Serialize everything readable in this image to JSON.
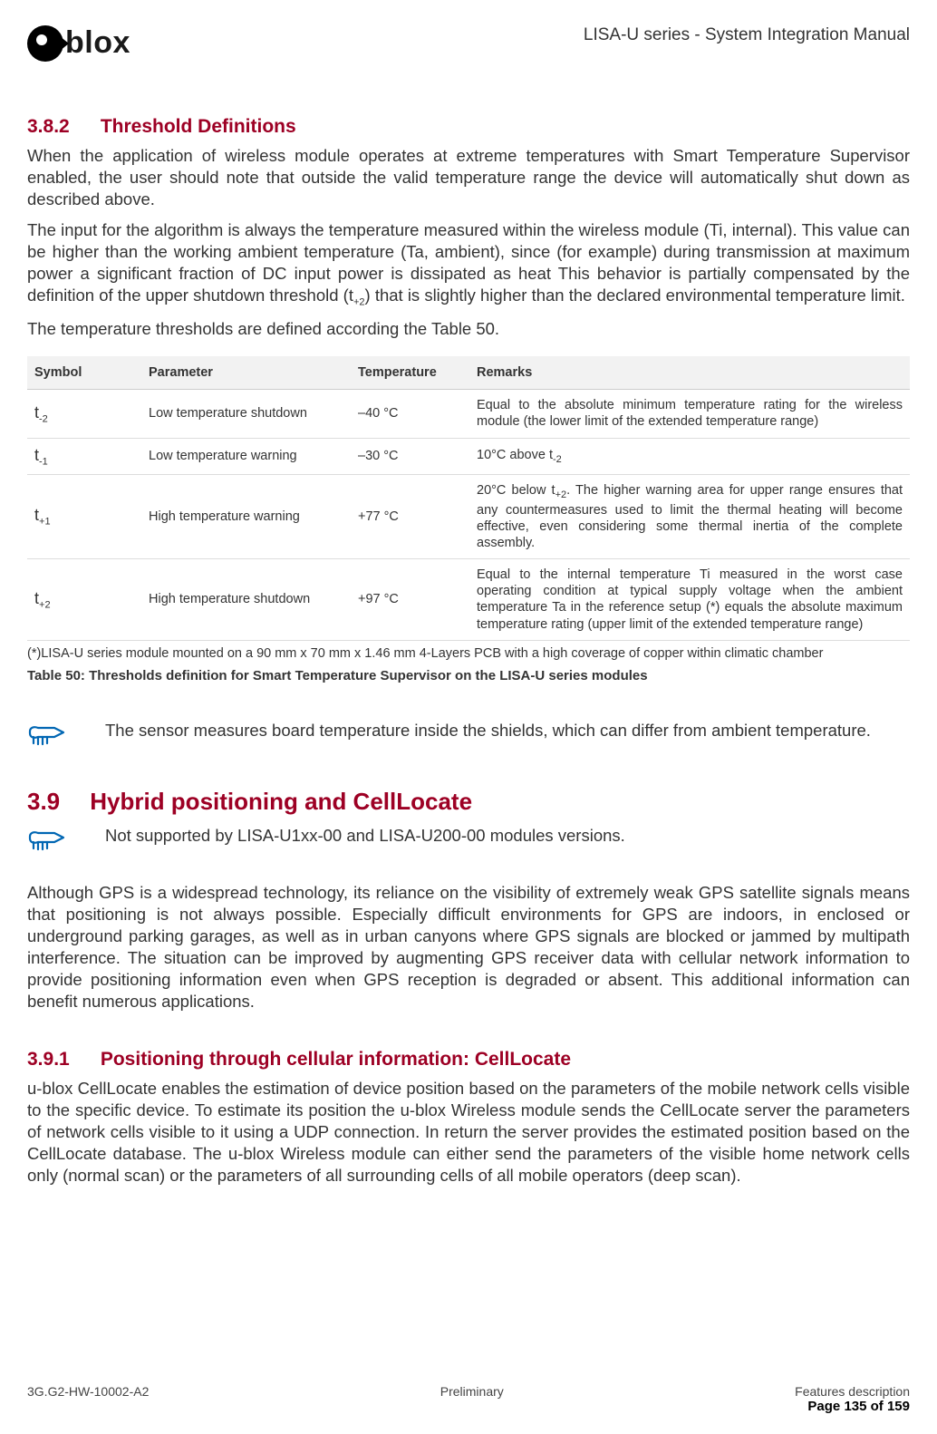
{
  "header": {
    "logo_text": "blox",
    "doc_title": "LISA-U series - System Integration Manual"
  },
  "s382": {
    "num": "3.8.2",
    "title": "Threshold Definitions",
    "p1": "When the application of wireless module operates at extreme temperatures with Smart Temperature Supervisor enabled, the user should note that outside the valid temperature range the device will automatically shut down as described above.",
    "p2a": "The input for the algorithm is always the temperature measured within the wireless module (Ti, internal). This value can be higher than the working ambient temperature (Ta, ambient), since (for example) during transmission at maximum power a significant fraction of DC input power is dissipated as heat This behavior is partially compensated by the definition of the upper shutdown threshold (t",
    "p2b": ") that is slightly higher than the declared environmental temperature limit.",
    "p3": "The temperature thresholds are defined according the Table 50."
  },
  "table": {
    "headers": {
      "c1": "Symbol",
      "c2": "Parameter",
      "c3": "Temperature",
      "c4": "Remarks"
    },
    "rows": [
      {
        "sym": "t",
        "sub": "-2",
        "param": "Low temperature shutdown",
        "temp": "–40 °C",
        "rem": "Equal to the absolute minimum temperature rating for the wireless module (the lower limit of the extended temperature range)"
      },
      {
        "sym": "t",
        "sub": "-1",
        "param": "Low temperature warning",
        "temp": "–30 °C",
        "rem_a": "10°C above t",
        "rem_sub": "-2"
      },
      {
        "sym": "t",
        "sub": "+1",
        "param": "High temperature warning",
        "temp": "+77 °C",
        "rem_a": "20°C below t",
        "rem_sub": "+2",
        "rem_b": ". The higher warning area for upper range ensures that any countermeasures used to limit the thermal heating will become effective, even considering some thermal inertia of the complete assembly."
      },
      {
        "sym": "t",
        "sub": "+2",
        "param": "High temperature shutdown",
        "temp": "+97 °C",
        "rem": "Equal to the internal temperature Ti measured in the worst case operating condition at typical supply voltage when the ambient temperature Ta in the reference setup (*) equals the absolute maximum temperature rating (upper limit of the extended temperature range)"
      }
    ],
    "footnote": "(*)LISA-U series module mounted on a 90 mm x 70 mm x 1.46 mm 4-Layers PCB with a high coverage of copper within climatic chamber",
    "caption": "Table 50: Thresholds definition for Smart Temperature Supervisor on the LISA-U series modules"
  },
  "note1": "The sensor measures board temperature inside the shields, which can differ from ambient temperature.",
  "s39": {
    "num": "3.9",
    "title": "Hybrid positioning and CellLocate",
    "note": "Not supported by LISA-U1xx-00 and LISA-U200-00 modules versions.",
    "p1": "Although GPS is a widespread technology, its reliance on the visibility of extremely weak GPS satellite signals means that positioning is not always possible. Especially difficult environments for GPS are indoors, in enclosed or underground parking garages, as well as in urban canyons where GPS signals are blocked or jammed by multipath interference. The situation can be improved by augmenting GPS receiver data with cellular network information to provide positioning information even when GPS reception is degraded or absent. This additional information can benefit numerous applications."
  },
  "s391": {
    "num": "3.9.1",
    "title": "Positioning through cellular information: CellLocate",
    "p1": "u-blox CellLocate enables the estimation of device position based on the parameters of the mobile network cells visible to the specific device. To estimate its position the u-blox Wireless module sends the CellLocate server the parameters of network cells visible to it using a UDP connection. In return the server provides the estimated position based on the CellLocate database. The u-blox Wireless module can either send the parameters of the visible home network cells only (normal scan) or the parameters of all surrounding cells of all mobile operators (deep scan)."
  },
  "footer": {
    "left": "3G.G2-HW-10002-A2",
    "center": "Preliminary",
    "right_top": "Features description",
    "right_bottom": "Page 135 of 159"
  }
}
